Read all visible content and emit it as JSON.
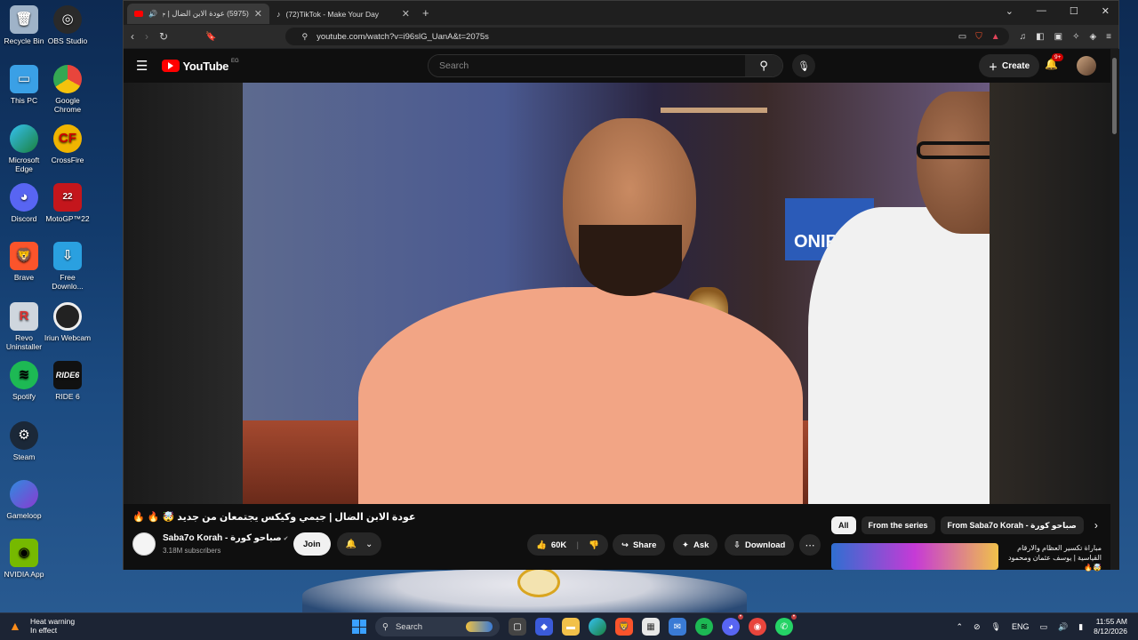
{
  "desktop": {
    "icons": [
      {
        "label": "Recycle Bin",
        "icon": "recycle-bin-icon",
        "color": "#9fb3c8"
      },
      {
        "label": "OBS Studio",
        "icon": "obs-icon",
        "color": "#2a2a2a"
      },
      {
        "label": "This PC",
        "icon": "this-pc-icon",
        "color": "#3aa0e6"
      },
      {
        "label": "Google Chrome",
        "icon": "chrome-icon",
        "color": "#e8453c"
      },
      {
        "label": "Microsoft Edge",
        "icon": "edge-icon",
        "color": "#1fa0d8"
      },
      {
        "label": "CrossFire",
        "icon": "crossfire-icon",
        "color": "#f0b400"
      },
      {
        "label": "Discord",
        "icon": "discord-icon",
        "color": "#5865f2"
      },
      {
        "label": "MotoGP™22",
        "icon": "motogp-icon",
        "color": "#c4161c"
      },
      {
        "label": "Brave",
        "icon": "brave-icon",
        "color": "#fb542b"
      },
      {
        "label": "Free Downlo...",
        "icon": "free-download-icon",
        "color": "#2aa0e0"
      },
      {
        "label": "Revo Uninstaller",
        "icon": "revo-icon",
        "color": "#d33"
      },
      {
        "label": "Iriun Webcam",
        "icon": "webcam-icon",
        "color": "#222"
      },
      {
        "label": "Spotify",
        "icon": "spotify-icon",
        "color": "#1db954"
      },
      {
        "label": "RIDE 6",
        "icon": "ride6-icon",
        "color": "#111"
      },
      {
        "label": "Steam",
        "icon": "steam-icon",
        "color": "#1b2838"
      },
      {
        "label": "Gameloop",
        "icon": "gameloop-icon",
        "color": "#2f8be0"
      },
      {
        "label": "NVIDIA App",
        "icon": "nvidia-icon",
        "color": "#76b900"
      }
    ]
  },
  "browser": {
    "tabs": [
      {
        "title": "(5975) عودة الابن الضال | جيمي...",
        "active": true
      },
      {
        "title": "(72)TikTok - Make Your Day",
        "active": false
      }
    ],
    "new_tab": "+",
    "url": "youtube.com/watch?v=i96slG_UanA&t=2075s"
  },
  "youtube": {
    "logo_text": "YouTube",
    "country": "EG",
    "search_placeholder": "Search",
    "create_label": "Create",
    "notif_badge": "9+",
    "video_title": "عودة الابن الضال | جيمي وكيكس يجتمعان من جديد 🤯 🔥 🔥",
    "sign_text": "ONIRO",
    "channel_name": "Saba7o Korah - صباحو كورة",
    "subscribers": "3.18M subscribers",
    "join_label": "Join",
    "like_count": "60K",
    "share_label": "Share",
    "ask_label": "Ask",
    "download_label": "Download",
    "chips": [
      "All",
      "From the series",
      "From Saba7o Korah - صباحو كورة"
    ],
    "reco_title": "مباراة تكسير العظام والارقام القياسية | يوسف عثمان ومحمود 🤯🔥"
  },
  "taskbar": {
    "heat_title": "Heat warning",
    "heat_sub": "In effect",
    "search_label": "Search",
    "lang": "ENG",
    "time": "11:55 AM",
    "date": "8/12/2026"
  }
}
